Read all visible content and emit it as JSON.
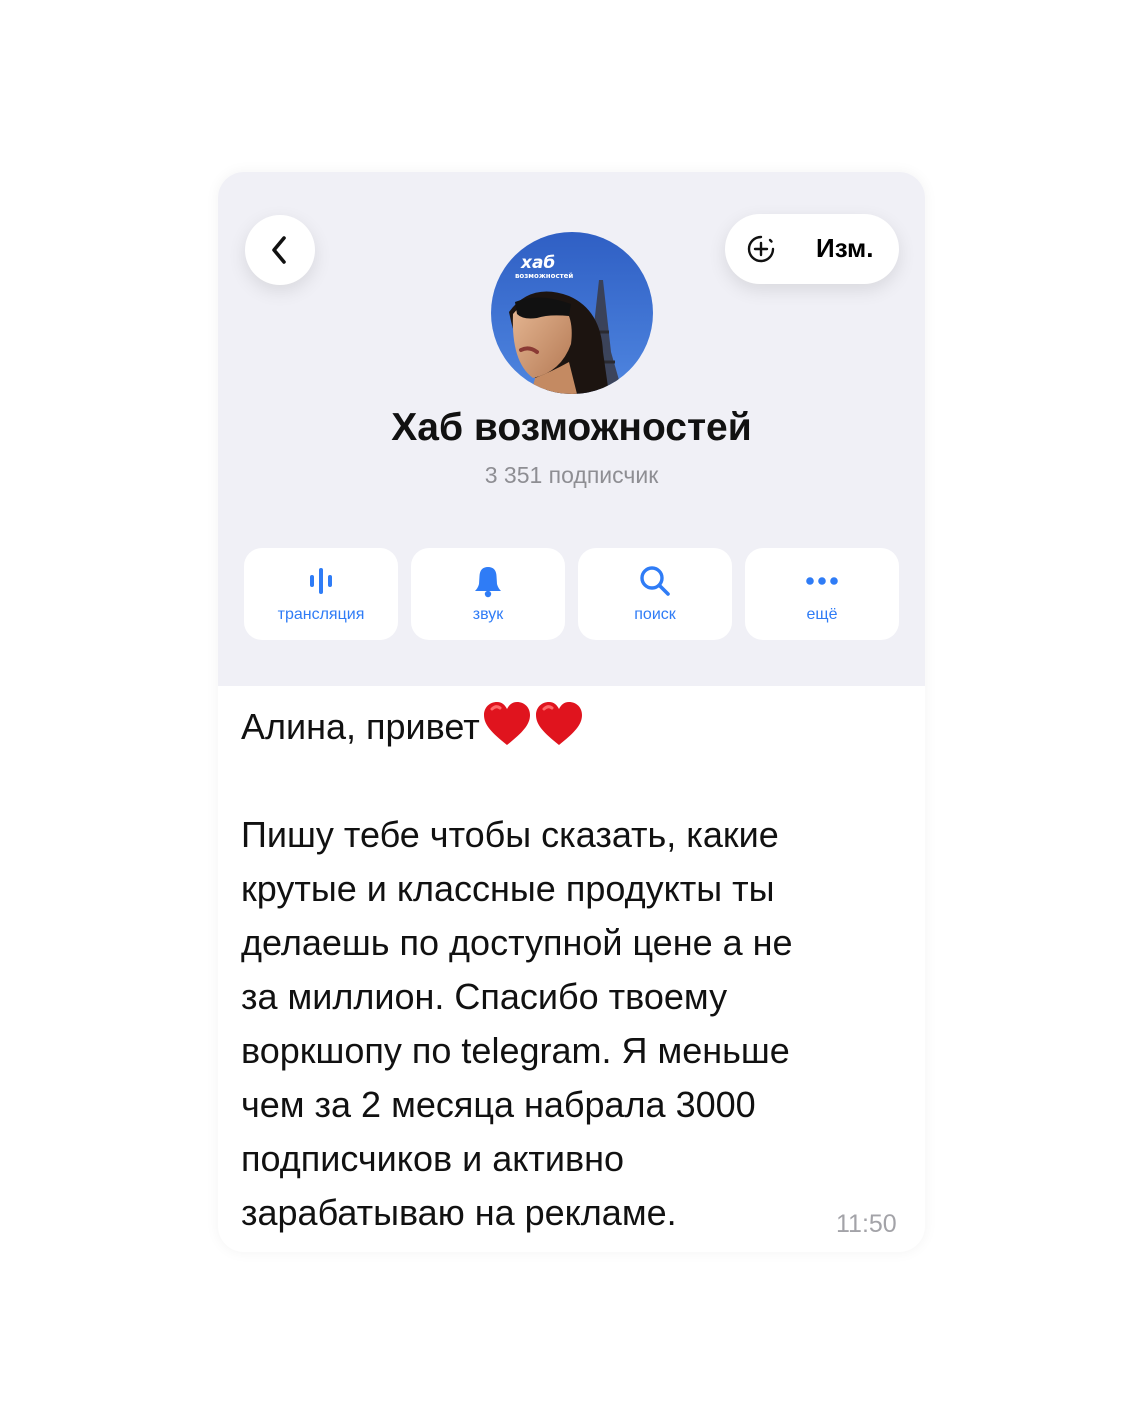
{
  "header": {
    "back_icon": "chevron-left-icon",
    "edit_icon": "add-circle-icon",
    "edit_label": "Изм.",
    "avatar_text_line1": "хаб",
    "avatar_text_line2": "возможностей"
  },
  "channel": {
    "title": "Хаб возможностей",
    "subscribers": "3 351 подписчик"
  },
  "actions": [
    {
      "label": "трансляция",
      "icon": "voice-chat-icon"
    },
    {
      "label": "звук",
      "icon": "bell-icon"
    },
    {
      "label": "поиск",
      "icon": "search-icon"
    },
    {
      "label": "ещё",
      "icon": "more-icon"
    }
  ],
  "message": {
    "greeting": "Алина, привет",
    "lines": [
      "Пишу тебе чтобы сказать, какие",
      "крутые и классные продукты ты",
      "делаешь по доступной цене а не",
      "за миллион. Спасибо твоему",
      "воркшопу по telegram. Я меньше",
      "чем за 2 месяца набрала 3000",
      "подписчиков и активно",
      "зарабатываю на рекламе."
    ],
    "time": "11:50"
  },
  "colors": {
    "accent": "#2f7cf6",
    "header_bg": "#f0f0f6",
    "heart": "#e0141e"
  }
}
